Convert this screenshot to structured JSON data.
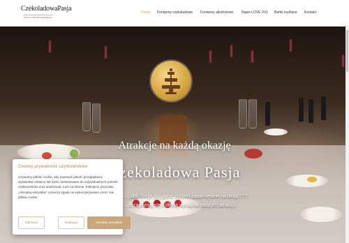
{
  "header": {
    "logo_text": "CzekoladowaPasja",
    "logo_subtext": "www.czekoladowapasja.pl",
    "nav": [
      {
        "label": "Home",
        "active": true
      },
      {
        "label": "Fontanny czekoladowe",
        "active": false
      },
      {
        "label": "Fontanny alkoholowe",
        "active": false
      },
      {
        "label": "Napis LOVE XXL",
        "active": false
      },
      {
        "label": "Bańki mydlane",
        "active": false
      },
      {
        "label": "Kontakt",
        "active": false
      }
    ]
  },
  "hero": {
    "headline": "Atrakcje na każdą okazję",
    "title": "Czekoladowa Pasja",
    "sub_line1": "…, aby Twoje przyjęcie zostało zapamiętane na długo???",
    "sub_line2": "…e zapoznaj się z ofertą wynajmu naszych atrakcji.",
    "logo_badge": "chocolate-fountain-logo"
  },
  "cookie": {
    "title": "Cenimy prywatność użytkowników",
    "text": "Używamy plików cookie, aby poprawić jakość przeglądania, wyświetlać reklamy lub treści dostosowane do indywidualnych potrzeb użytkowników oraz analizować ruch na stronie. Kliknięcie przycisku „Akceptuj wszystkie” oznacza zgodę na wykorzystywanie przez nas plików cookie.",
    "reject_label": "Odrzucić",
    "customize_label": "Dostosuj",
    "accept_label": "Akceptuj wszystkie"
  },
  "colors": {
    "accent": "#c9a77a",
    "header_bg": "#ffffff"
  }
}
